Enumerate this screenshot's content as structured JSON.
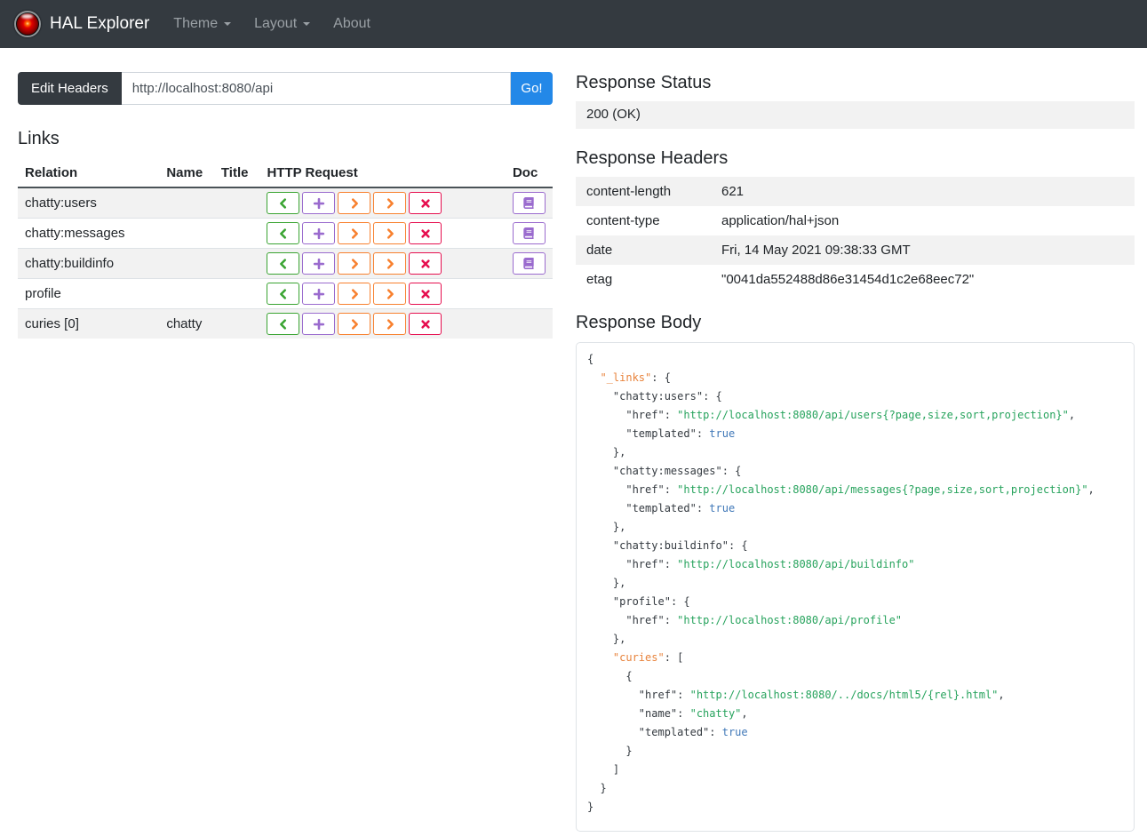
{
  "navbar": {
    "brand": "HAL Explorer",
    "items": [
      {
        "label": "Theme",
        "dropdown": true
      },
      {
        "label": "Layout",
        "dropdown": true
      },
      {
        "label": "About",
        "dropdown": false
      }
    ]
  },
  "request_bar": {
    "edit_headers_label": "Edit Headers",
    "url_value": "http://localhost:8080/api",
    "go_label": "Go!"
  },
  "links": {
    "title": "Links",
    "columns": [
      "Relation",
      "Name",
      "Title",
      "HTTP Request",
      "Doc"
    ],
    "http_buttons": [
      {
        "name": "get-request-button",
        "icon": "chevron-left-icon",
        "color": "#3aa432"
      },
      {
        "name": "post-request-button",
        "icon": "plus-icon",
        "color": "#9a6bce"
      },
      {
        "name": "put-request-button",
        "icon": "chevron-right-icon",
        "color": "#f8802e"
      },
      {
        "name": "patch-request-button",
        "icon": "chevron-right-icon",
        "color": "#f8802e"
      },
      {
        "name": "delete-request-button",
        "icon": "x-icon",
        "color": "#e60f4f"
      }
    ],
    "doc_button": {
      "name": "doc-button",
      "icon": "book-icon",
      "color": "#9a6bce"
    },
    "rows": [
      {
        "relation": "chatty:users",
        "name": "",
        "title": "",
        "doc": true
      },
      {
        "relation": "chatty:messages",
        "name": "",
        "title": "",
        "doc": true
      },
      {
        "relation": "chatty:buildinfo",
        "name": "",
        "title": "",
        "doc": true
      },
      {
        "relation": "profile",
        "name": "",
        "title": "",
        "doc": false
      },
      {
        "relation": "curies [0]",
        "name": "chatty",
        "title": "",
        "doc": false
      }
    ]
  },
  "response": {
    "status_title": "Response Status",
    "status_value": "200 (OK)",
    "headers_title": "Response Headers",
    "headers": [
      {
        "key": "content-length",
        "value": "621"
      },
      {
        "key": "content-type",
        "value": "application/hal+json"
      },
      {
        "key": "date",
        "value": "Fri, 14 May 2021 09:38:33 GMT"
      },
      {
        "key": "etag",
        "value": "\"0041da552488d86e31454d1c2e68eec72\""
      }
    ],
    "body_title": "Response Body",
    "body_lines": [
      [
        {
          "c": "p",
          "t": "{"
        }
      ],
      [
        {
          "c": "p",
          "t": "  "
        },
        {
          "c": "h",
          "t": "\"_links\""
        },
        {
          "c": "p",
          "t": ": {"
        }
      ],
      [
        {
          "c": "p",
          "t": "    "
        },
        {
          "c": "k",
          "t": "\"chatty:users\""
        },
        {
          "c": "p",
          "t": ": {"
        }
      ],
      [
        {
          "c": "p",
          "t": "      "
        },
        {
          "c": "k",
          "t": "\"href\""
        },
        {
          "c": "p",
          "t": ": "
        },
        {
          "c": "s",
          "t": "\"http://localhost:8080/api/users{?page,size,sort,projection}\""
        },
        {
          "c": "p",
          "t": ","
        }
      ],
      [
        {
          "c": "p",
          "t": "      "
        },
        {
          "c": "k",
          "t": "\"templated\""
        },
        {
          "c": "p",
          "t": ": "
        },
        {
          "c": "b",
          "t": "true"
        }
      ],
      [
        {
          "c": "p",
          "t": "    },"
        }
      ],
      [
        {
          "c": "p",
          "t": "    "
        },
        {
          "c": "k",
          "t": "\"chatty:messages\""
        },
        {
          "c": "p",
          "t": ": {"
        }
      ],
      [
        {
          "c": "p",
          "t": "      "
        },
        {
          "c": "k",
          "t": "\"href\""
        },
        {
          "c": "p",
          "t": ": "
        },
        {
          "c": "s",
          "t": "\"http://localhost:8080/api/messages{?page,size,sort,projection}\""
        },
        {
          "c": "p",
          "t": ","
        }
      ],
      [
        {
          "c": "p",
          "t": "      "
        },
        {
          "c": "k",
          "t": "\"templated\""
        },
        {
          "c": "p",
          "t": ": "
        },
        {
          "c": "b",
          "t": "true"
        }
      ],
      [
        {
          "c": "p",
          "t": "    },"
        }
      ],
      [
        {
          "c": "p",
          "t": "    "
        },
        {
          "c": "k",
          "t": "\"chatty:buildinfo\""
        },
        {
          "c": "p",
          "t": ": {"
        }
      ],
      [
        {
          "c": "p",
          "t": "      "
        },
        {
          "c": "k",
          "t": "\"href\""
        },
        {
          "c": "p",
          "t": ": "
        },
        {
          "c": "s",
          "t": "\"http://localhost:8080/api/buildinfo\""
        }
      ],
      [
        {
          "c": "p",
          "t": "    },"
        }
      ],
      [
        {
          "c": "p",
          "t": "    "
        },
        {
          "c": "k",
          "t": "\"profile\""
        },
        {
          "c": "p",
          "t": ": {"
        }
      ],
      [
        {
          "c": "p",
          "t": "      "
        },
        {
          "c": "k",
          "t": "\"href\""
        },
        {
          "c": "p",
          "t": ": "
        },
        {
          "c": "s",
          "t": "\"http://localhost:8080/api/profile\""
        }
      ],
      [
        {
          "c": "p",
          "t": "    },"
        }
      ],
      [
        {
          "c": "p",
          "t": "    "
        },
        {
          "c": "h",
          "t": "\"curies\""
        },
        {
          "c": "p",
          "t": ": ["
        }
      ],
      [
        {
          "c": "p",
          "t": "      {"
        }
      ],
      [
        {
          "c": "p",
          "t": "        "
        },
        {
          "c": "k",
          "t": "\"href\""
        },
        {
          "c": "p",
          "t": ": "
        },
        {
          "c": "s",
          "t": "\"http://localhost:8080/../docs/html5/{rel}.html\""
        },
        {
          "c": "p",
          "t": ","
        }
      ],
      [
        {
          "c": "p",
          "t": "        "
        },
        {
          "c": "k",
          "t": "\"name\""
        },
        {
          "c": "p",
          "t": ": "
        },
        {
          "c": "s",
          "t": "\"chatty\""
        },
        {
          "c": "p",
          "t": ","
        }
      ],
      [
        {
          "c": "p",
          "t": "        "
        },
        {
          "c": "k",
          "t": "\"templated\""
        },
        {
          "c": "p",
          "t": ": "
        },
        {
          "c": "b",
          "t": "true"
        }
      ],
      [
        {
          "c": "p",
          "t": "      }"
        }
      ],
      [
        {
          "c": "p",
          "t": "    ]"
        }
      ],
      [
        {
          "c": "p",
          "t": "  }"
        }
      ],
      [
        {
          "c": "p",
          "t": "}"
        }
      ]
    ]
  }
}
